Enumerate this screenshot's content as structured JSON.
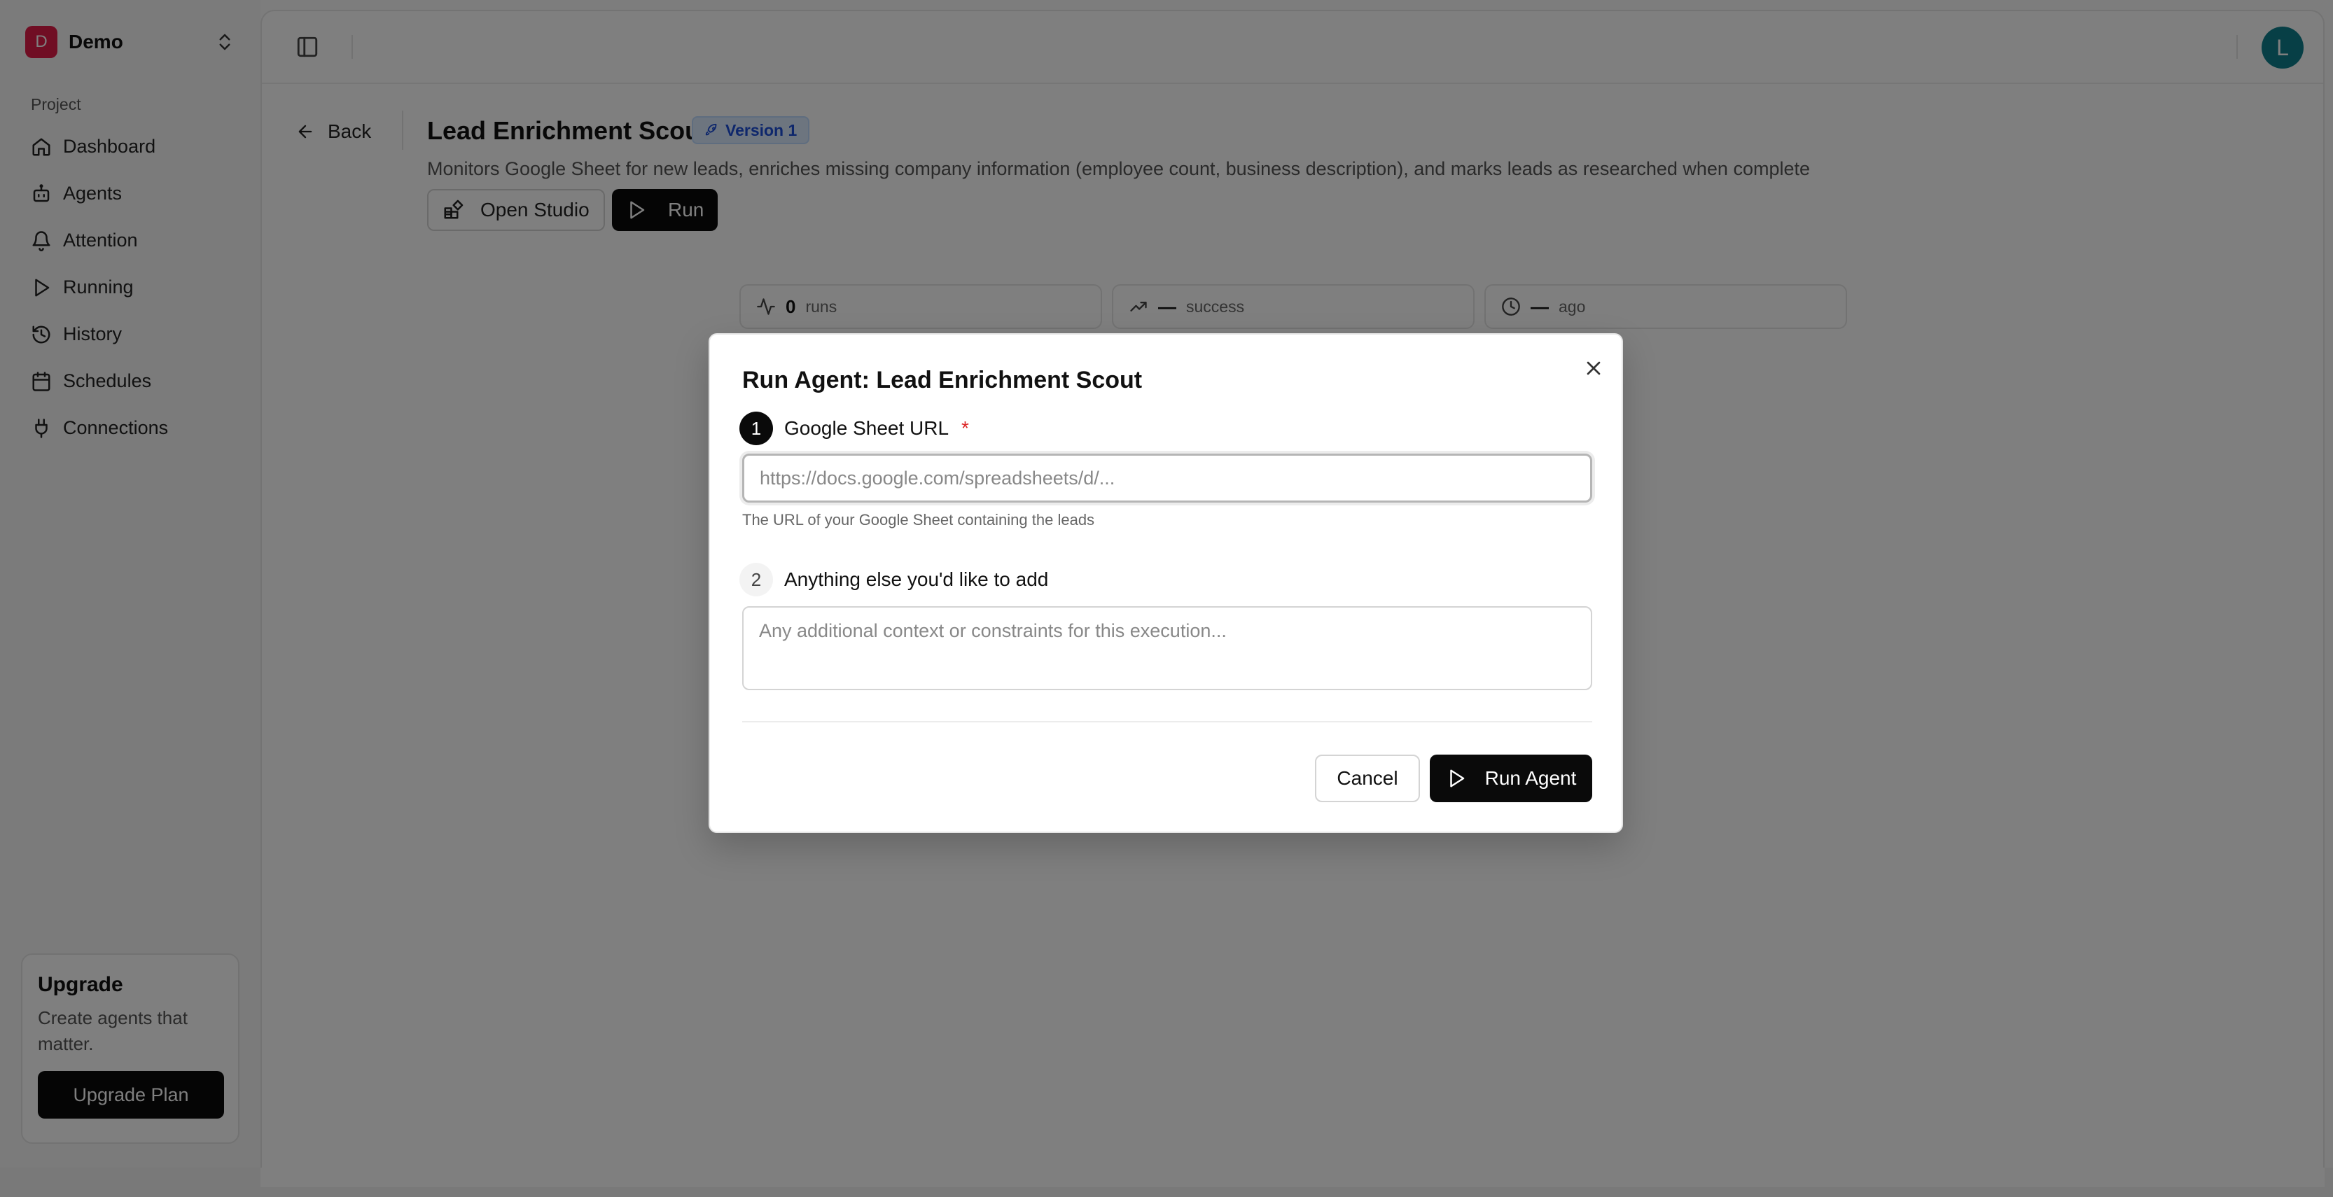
{
  "sidebar": {
    "workspace": {
      "initial": "D",
      "name": "Demo"
    },
    "section_label": "Project",
    "items": [
      {
        "label": "Dashboard",
        "icon": "home-icon"
      },
      {
        "label": "Agents",
        "icon": "bot-icon"
      },
      {
        "label": "Attention",
        "icon": "bell-icon"
      },
      {
        "label": "Running",
        "icon": "play-icon"
      },
      {
        "label": "History",
        "icon": "history-icon"
      },
      {
        "label": "Schedules",
        "icon": "calendar-icon"
      },
      {
        "label": "Connections",
        "icon": "plug-icon"
      }
    ],
    "upgrade": {
      "title": "Upgrade",
      "text": "Create agents that matter.",
      "button": "Upgrade Plan"
    }
  },
  "topbar": {
    "avatar_initial": "L",
    "avatar_color": "#0e7f8c"
  },
  "agent": {
    "back_label": "Back",
    "title": "Lead Enrichment Scout",
    "version": "Version 1",
    "description": "Monitors Google Sheet for new leads, enriches missing company information (employee count, business description), and marks leads as researched when complete",
    "open_studio_label": "Open Studio",
    "run_label": "Run"
  },
  "stats": [
    {
      "value": "0",
      "label": "runs",
      "icon": "activity-icon"
    },
    {
      "value": "—",
      "label": "success",
      "icon": "trending-up-icon"
    },
    {
      "value": "—",
      "label": "ago",
      "icon": "clock-icon"
    }
  ],
  "modal": {
    "title": "Run Agent: Lead Enrichment Scout",
    "fields": [
      {
        "step": "1",
        "label": "Google Sheet URL",
        "required_mark": "*",
        "placeholder": "https://docs.google.com/spreadsheets/d/...",
        "value": "",
        "help": "The URL of your Google Sheet containing the leads"
      },
      {
        "step": "2",
        "label": "Anything else you'd like to add",
        "placeholder": "Any additional context or constraints for this execution...",
        "value": ""
      }
    ],
    "cancel_label": "Cancel",
    "run_label": "Run Agent"
  },
  "colors": {
    "workspace_badge": "#e11d48",
    "primary_button": "#0a0a0a",
    "version_badge_text": "#1d4ed8",
    "required": "#dc2626"
  }
}
